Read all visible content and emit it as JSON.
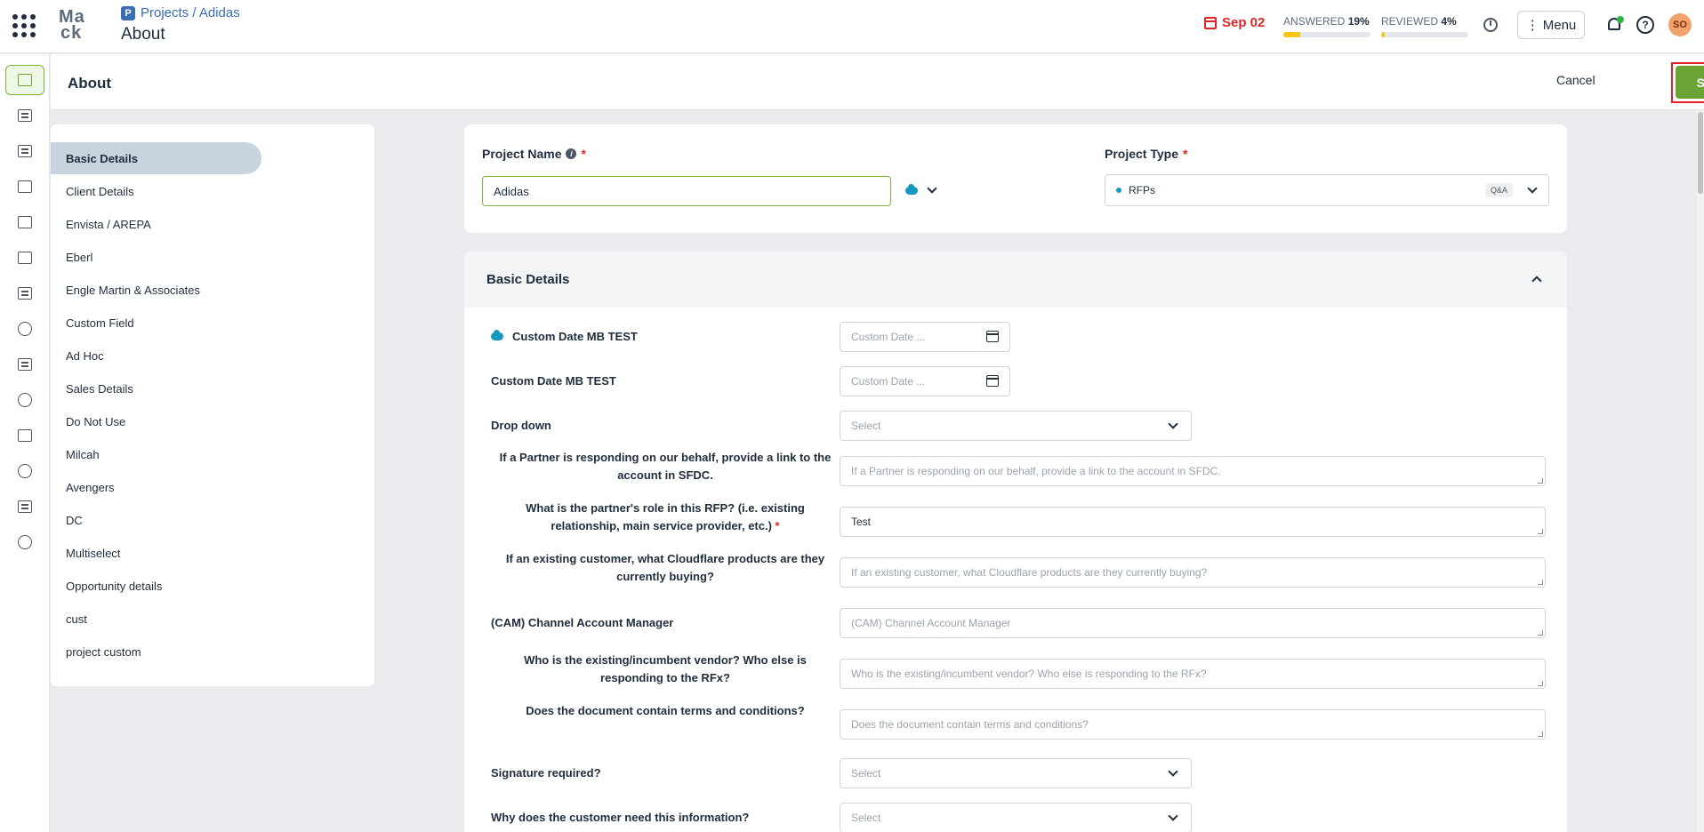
{
  "header": {
    "breadcrumb": "Projects / Adidas",
    "project_icon_letter": "P",
    "page_title": "About",
    "logo_line1": "Ma",
    "logo_line2": "ck",
    "due_date": "Sep 02",
    "answered_label": "ANSWERED",
    "answered_pct": "19%",
    "answered_fraction": 0.19,
    "reviewed_label": "REVIEWED",
    "reviewed_pct": "4%",
    "reviewed_fraction": 0.04,
    "menu_label": "Menu",
    "help_label": "?",
    "avatar_initials": "SO"
  },
  "subheader": {
    "title": "About",
    "cancel_label": "Cancel",
    "save_label": "Save"
  },
  "section_nav": [
    "Basic Details",
    "Client Details",
    "Envista / AREPA",
    "Eberl",
    "Engle Martin & Associates",
    "Custom Field",
    "Ad Hoc",
    "Sales Details",
    "Do Not Use",
    "Milcah",
    "Avengers",
    "DC",
    "Multiselect",
    "Opportunity details",
    "cust",
    "project custom"
  ],
  "project": {
    "name_label": "Project Name",
    "name_value": "Adidas",
    "type_label": "Project Type",
    "type_value": "RFPs",
    "type_chip": "Q&A",
    "required_mark": "*"
  },
  "basic_details": {
    "title": "Basic Details",
    "fields": [
      {
        "label": "Custom Date MB TEST",
        "placeholder": "Custom Date ...",
        "kind": "date",
        "salesforce": true
      },
      {
        "label": "Custom Date MB TEST",
        "placeholder": "Custom Date ...",
        "kind": "date"
      },
      {
        "label": "Drop down",
        "placeholder": "Select",
        "kind": "select"
      },
      {
        "label": "If a Partner is responding on our behalf, provide a link to the account in SFDC.",
        "placeholder": "If a Partner is responding on our behalf, provide a link to the account in SFDC.",
        "kind": "text"
      },
      {
        "label": "What is the partner's role in this RFP? (i.e. existing relationship, main service provider, etc.)",
        "value": "Test",
        "kind": "text",
        "required": true
      },
      {
        "label": "If an existing customer, what Cloudflare products are they currently buying?",
        "placeholder": "If an existing customer, what Cloudflare products are they currently buying?",
        "kind": "text"
      },
      {
        "label": "(CAM) Channel Account Manager",
        "placeholder": "(CAM) Channel Account Manager",
        "kind": "text"
      },
      {
        "label": "Who is the existing/incumbent vendor? Who else is responding to the RFx?",
        "placeholder": "Who is the existing/incumbent vendor? Who else is responding to the RFx?",
        "kind": "text"
      },
      {
        "label": "Does the document contain terms and conditions?",
        "placeholder": "Does the document contain terms and conditions?",
        "kind": "text"
      },
      {
        "label": "Signature required?",
        "placeholder": "Select",
        "kind": "select"
      },
      {
        "label": "Why does the customer need this information?",
        "placeholder": "Select",
        "kind": "select"
      }
    ]
  },
  "colors": {
    "accent_green": "#6aa434",
    "highlight_red": "#e0212c",
    "due_red": "#e02424",
    "progress_yellow": "#f5c518"
  }
}
